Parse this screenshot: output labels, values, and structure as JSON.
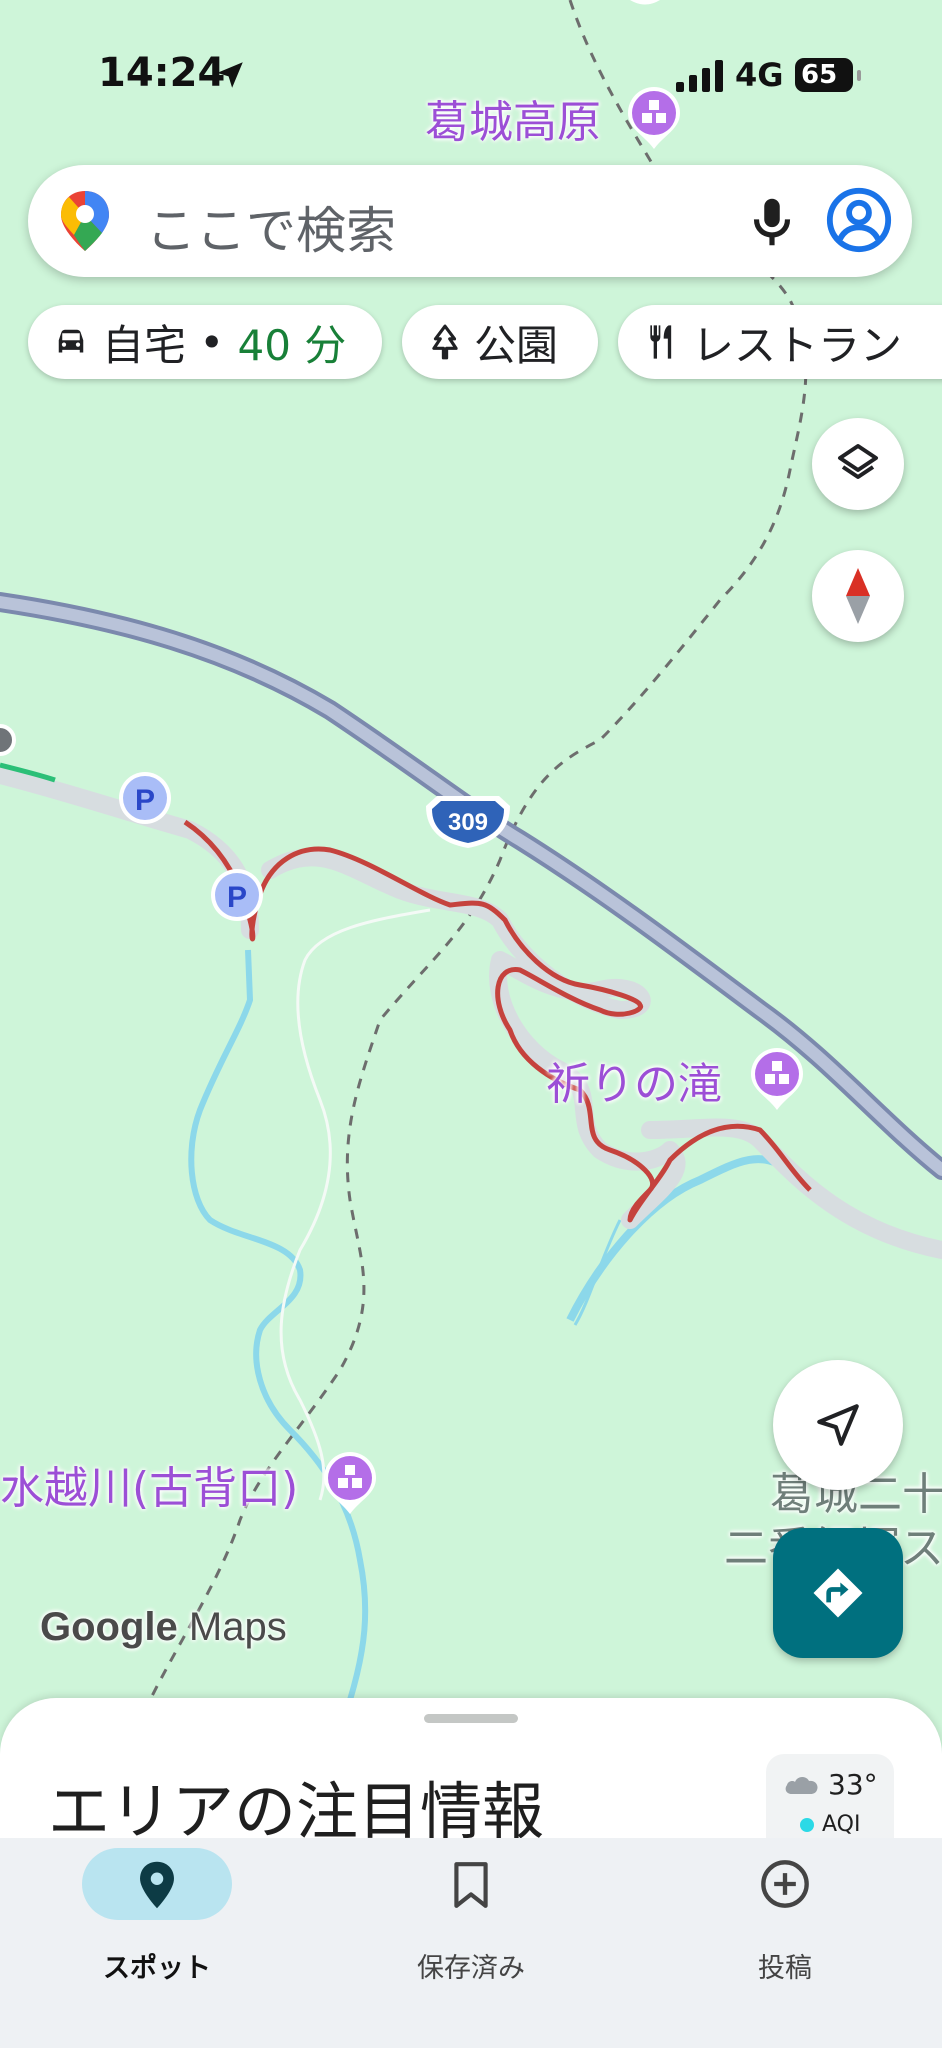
{
  "status_bar": {
    "time": "14:24",
    "network": "4G",
    "battery": "65"
  },
  "search": {
    "placeholder": "ここで検索"
  },
  "chips": [
    {
      "label": "自宅",
      "sep": " • ",
      "eta": "40 分",
      "icon": "car-icon"
    },
    {
      "label": "公園",
      "icon": "tree-icon"
    },
    {
      "label": "レストラン",
      "icon": "fork-knife-icon"
    }
  ],
  "map": {
    "places": [
      {
        "name": "葛城高原",
        "icon": "attraction-pin-icon"
      },
      {
        "name": "祈りの滝",
        "icon": "attraction-pin-icon"
      },
      {
        "name": "水越川(古背口)",
        "icon": "attraction-pin-icon"
      }
    ],
    "partial_labels": {
      "line1": "葛城二十",
      "line2": "二番経塚ス"
    },
    "route_shield": "309",
    "parking_label": "P",
    "colors": {
      "land": "#cef5d9",
      "highway": "#9aa7c4",
      "congestion": "#c5423d",
      "water": "#8cd8ea",
      "place_label": "#9c4fd6"
    }
  },
  "controls": {
    "layers": "layers-icon",
    "compass": "compass-icon",
    "my_location": "navigation-arrow-icon",
    "directions": "directions-icon"
  },
  "logo": {
    "google": "Google",
    "maps": "Maps"
  },
  "sheet": {
    "title": "エリアの注目情報",
    "weather": {
      "temp": "33°",
      "aqi": "AQI",
      "icon": "cloud-icon"
    }
  },
  "nav": [
    {
      "label": "スポット",
      "active": true,
      "icon": "location-pin-icon"
    },
    {
      "label": "保存済み",
      "active": false,
      "icon": "bookmark-icon"
    },
    {
      "label": "投稿",
      "active": false,
      "icon": "add-circle-icon"
    }
  ]
}
